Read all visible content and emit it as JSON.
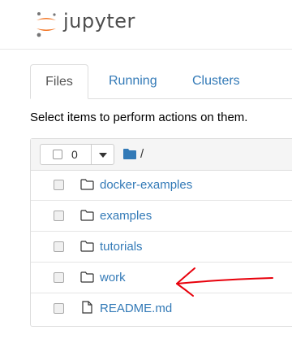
{
  "header": {
    "logo_text": "jupyter"
  },
  "tabs": [
    {
      "label": "Files"
    },
    {
      "label": "Running"
    },
    {
      "label": "Clusters"
    }
  ],
  "hint": "Select items to perform actions on them.",
  "toolbar": {
    "selected_count": "0",
    "breadcrumb": "/"
  },
  "files": [
    {
      "name": "docker-examples",
      "type": "folder"
    },
    {
      "name": "examples",
      "type": "folder"
    },
    {
      "name": "tutorials",
      "type": "folder"
    },
    {
      "name": "work",
      "type": "folder"
    },
    {
      "name": "README.md",
      "type": "file"
    }
  ],
  "colors": {
    "link": "#337ab7",
    "annotation": "#e8000b",
    "logo_orange": "#f37726"
  }
}
